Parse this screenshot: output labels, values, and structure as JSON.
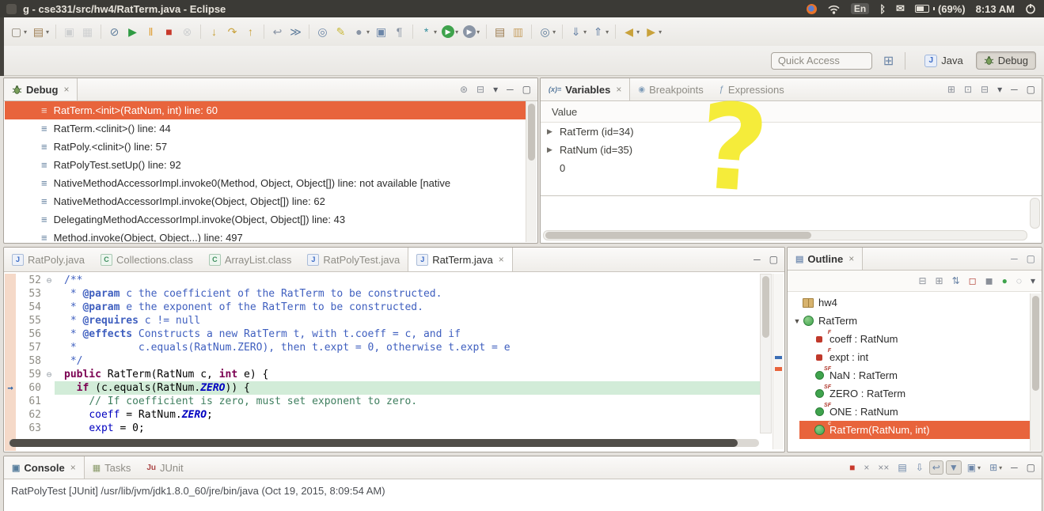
{
  "ui": {
    "close_glyph": "×",
    "menu_glyph": "▾",
    "min_glyph": "─",
    "max_glyph": "▢",
    "expand_glyph": "▶",
    "collapse_glyph": "▼",
    "fold_glyph": "⊖",
    "arrow_glyph": "→"
  },
  "titlebar": {
    "title": "g - cse331/src/hw4/RatTerm.java - Eclipse",
    "tray": [
      {
        "name": "firefox-indicator",
        "type": "firefox"
      },
      {
        "name": "network-indicator",
        "type": "wifi"
      },
      {
        "name": "keyboard-indicator",
        "type": "text-badge",
        "label": "En"
      },
      {
        "name": "bluetooth-indicator",
        "type": "glyph",
        "glyph": "ᛒ"
      },
      {
        "name": "mail-indicator",
        "type": "glyph",
        "glyph": "✉"
      },
      {
        "name": "battery-indicator",
        "type": "battery",
        "label": "(69%)"
      },
      {
        "name": "clock",
        "type": "text",
        "label": "8:13 AM"
      },
      {
        "name": "session-indicator",
        "type": "power"
      }
    ]
  },
  "toolbar": {
    "quick_access": "Quick Access",
    "open_perspective_glyph": "⊞",
    "perspectives": [
      {
        "label": "Java",
        "icon": "java",
        "active": false
      },
      {
        "label": "Debug",
        "icon": "bug",
        "active": true
      }
    ],
    "icons": [
      {
        "name": "new-wizard-button",
        "glyph": "▢",
        "color": "#8A8273",
        "dropdown": true
      },
      {
        "name": "new-java-project-button",
        "glyph": "▤",
        "color": "#9B7B4F",
        "dropdown": true
      },
      {
        "sep": true
      },
      {
        "name": "save-button",
        "glyph": "▣",
        "color": "#9AA0A8",
        "disabled": true
      },
      {
        "name": "save-all-button",
        "glyph": "▦",
        "color": "#9AA0A8",
        "disabled": true
      },
      {
        "sep": true
      },
      {
        "name": "skip-all-breakpoints-button",
        "glyph": "⊘",
        "color": "#5F7D9C"
      },
      {
        "name": "resume-button",
        "glyph": "▶",
        "color": "#2F9B43"
      },
      {
        "name": "suspend-button",
        "glyph": "‖",
        "color": "#DE9A2B"
      },
      {
        "name": "terminate-button",
        "glyph": "■",
        "color": "#C8392B"
      },
      {
        "name": "disconnect-button",
        "glyph": "⊗",
        "color": "#9AA0A8",
        "disabled": true
      },
      {
        "sep": true
      },
      {
        "name": "step-into-button",
        "glyph": "↓",
        "color": "#C9A23B"
      },
      {
        "name": "step-over-button",
        "glyph": "↷",
        "color": "#C9A23B"
      },
      {
        "name": "step-return-button",
        "glyph": "↑",
        "color": "#C9A23B"
      },
      {
        "sep": true
      },
      {
        "name": "drop-to-frame-button",
        "glyph": "↩",
        "color": "#8A95A5"
      },
      {
        "name": "use-step-filters-button",
        "glyph": "≫",
        "color": "#5F7D9C"
      },
      {
        "sep": true
      },
      {
        "name": "open-search-dialog-button",
        "glyph": "◎",
        "color": "#6C86A8"
      },
      {
        "name": "mark-occurrences-button",
        "glyph": "✎",
        "color": "#C9B93B"
      },
      {
        "name": "last-edit-location-button",
        "glyph": "●",
        "color": "#8A95A5",
        "dropdown": true
      },
      {
        "name": "pin-editor-button",
        "glyph": "▣",
        "color": "#6C86A8"
      },
      {
        "name": "show-whitespace-button",
        "glyph": "¶",
        "color": "#8A95A5"
      },
      {
        "sep": true
      },
      {
        "name": "new-java-class-button",
        "glyph": "*",
        "color": "#2E8B9B",
        "dropdown": true
      },
      {
        "name": "run-button",
        "glyph": "▶",
        "color": "#FFFFFF",
        "bg": "#3FA34D",
        "round": true,
        "dropdown": true
      },
      {
        "name": "external-tools-button",
        "glyph": "▶",
        "color": "#FFFFFF",
        "bg": "#8A95A5",
        "round": true,
        "dropdown": true
      },
      {
        "sep": true
      },
      {
        "name": "open-type-button",
        "glyph": "▤",
        "color": "#9B7B4F"
      },
      {
        "name": "open-resource-button",
        "glyph": "▥",
        "color": "#C8A165"
      },
      {
        "sep": true
      },
      {
        "name": "search-button",
        "glyph": "◎",
        "color": "#5F7D9C",
        "dropdown": true
      },
      {
        "sep": true
      },
      {
        "name": "next-annotation-button",
        "glyph": "⇓",
        "color": "#6C86A8",
        "dropdown": true
      },
      {
        "name": "previous-annotation-button",
        "glyph": "⇑",
        "color": "#6C86A8",
        "dropdown": true
      },
      {
        "sep": true
      },
      {
        "name": "back-button",
        "glyph": "◀",
        "color": "#C9A23B",
        "dropdown": true
      },
      {
        "name": "forward-button",
        "glyph": "▶",
        "color": "#C9A23B",
        "dropdown": true
      }
    ]
  },
  "debug_panel": {
    "tab_label": "Debug",
    "frame_icon_glyph": "≡",
    "toolbar_buttons": [
      {
        "name": "view-management-button",
        "glyph": "⊛",
        "color": "#8A8F98"
      },
      {
        "name": "collapse-all-button",
        "glyph": "⊟",
        "color": "#8A8F98"
      },
      {
        "name": "view-menu-button",
        "glyph": "▾",
        "color": "#5A5D63"
      },
      {
        "name": "minimize-button",
        "glyph": "─",
        "color": "#5A5D63"
      },
      {
        "name": "maximize-button",
        "glyph": "▢",
        "color": "#5A5D63"
      }
    ],
    "frames": [
      {
        "label": "RatTerm.<init>(RatNum, int) line: 60",
        "selected": true
      },
      {
        "label": "RatTerm.<clinit>() line: 44"
      },
      {
        "label": "RatPoly.<clinit>() line: 57"
      },
      {
        "label": "RatPolyTest.setUp() line: 92"
      },
      {
        "label": "NativeMethodAccessorImpl.invoke0(Method, Object, Object[]) line: not available [native"
      },
      {
        "label": "NativeMethodAccessorImpl.invoke(Object, Object[]) line: 62"
      },
      {
        "label": "DelegatingMethodAccessorImpl.invoke(Object, Object[]) line: 43"
      },
      {
        "label": "Method.invoke(Object, Object...) line: 497"
      }
    ]
  },
  "variables_panel": {
    "tabs": [
      {
        "label": "Variables",
        "icon": "variables-icon",
        "icon_text": "(x)=",
        "active": true,
        "closable": true
      },
      {
        "label": "Breakpoints",
        "icon": "breakpoints-icon",
        "icon_text": "◉"
      },
      {
        "label": "Expressions",
        "icon": "expressions-icon",
        "icon_text": "ƒ"
      }
    ],
    "toolbar_buttons": [
      {
        "name": "show-type-names-button",
        "glyph": "⊞",
        "color": "#8A8F98"
      },
      {
        "name": "show-logical-structure-button",
        "glyph": "⊡",
        "color": "#8A8F98"
      },
      {
        "name": "collapse-all-button",
        "glyph": "⊟",
        "color": "#8A8F98"
      },
      {
        "name": "view-menu-button",
        "glyph": "▾",
        "color": "#5A5D63"
      },
      {
        "name": "minimize-button",
        "glyph": "─",
        "color": "#5A5D63"
      },
      {
        "name": "maximize-button",
        "glyph": "▢",
        "color": "#5A5D63"
      }
    ],
    "column_header": "Value",
    "rows": [
      {
        "text": "RatTerm (id=34)",
        "expandable": true
      },
      {
        "text": "RatNum (id=35)",
        "expandable": true
      },
      {
        "text": "0",
        "expandable": false
      }
    ],
    "annotation_glyph": "?"
  },
  "editor": {
    "tabs": [
      {
        "label": "RatPoly.java",
        "kind": "java"
      },
      {
        "label": "Collections.class",
        "kind": "class"
      },
      {
        "label": "ArrayList.class",
        "kind": "class"
      },
      {
        "label": "RatPolyTest.java",
        "kind": "java"
      },
      {
        "label": "RatTerm.java",
        "kind": "java",
        "active": true
      }
    ],
    "toolbar_buttons": [
      {
        "name": "minimize-button",
        "glyph": "─",
        "color": "#5A5D63"
      },
      {
        "name": "maximize-button",
        "glyph": "▢",
        "color": "#5A5D63"
      }
    ],
    "lines": [
      {
        "num": 52,
        "fold": true,
        "segs": [
          [
            "/**",
            "jdoc"
          ]
        ]
      },
      {
        "num": 53,
        "segs": [
          [
            " * ",
            "jdoc"
          ],
          [
            "@param",
            "jtag"
          ],
          [
            " c the coefficient of the RatTerm to be constructed.",
            "jdoc"
          ]
        ]
      },
      {
        "num": 54,
        "segs": [
          [
            " * ",
            "jdoc"
          ],
          [
            "@param",
            "jtag"
          ],
          [
            " e the exponent of the RatTerm to be constructed.",
            "jdoc"
          ]
        ]
      },
      {
        "num": 55,
        "segs": [
          [
            " * ",
            "jdoc"
          ],
          [
            "@requires",
            "jtag"
          ],
          [
            " c != null",
            "jdoc"
          ]
        ]
      },
      {
        "num": 56,
        "segs": [
          [
            " * ",
            "jdoc"
          ],
          [
            "@effects",
            "jtag"
          ],
          [
            " Constructs a new RatTerm t, with t.coeff = c, and if",
            "jdoc"
          ]
        ]
      },
      {
        "num": 57,
        "segs": [
          [
            " *          c.equals(RatNum.ZERO), then t.expt = 0, otherwise t.expt = e",
            "jdoc"
          ]
        ]
      },
      {
        "num": 58,
        "segs": [
          [
            " */",
            "jdoc"
          ]
        ]
      },
      {
        "num": 59,
        "fold": true,
        "segs": [
          [
            "public",
            "kw"
          ],
          [
            " RatTerm(RatNum c, ",
            "pln"
          ],
          [
            "int",
            "kw"
          ],
          [
            " e) {",
            "pln"
          ]
        ]
      },
      {
        "num": 60,
        "current": true,
        "segs": [
          [
            "  ",
            "pln"
          ],
          [
            "if",
            "kw"
          ],
          [
            " (c.equals(RatNum.",
            "pln"
          ],
          [
            "ZERO",
            "sfield"
          ],
          [
            ")) {",
            "pln"
          ]
        ]
      },
      {
        "num": 61,
        "segs": [
          [
            "    ",
            "pln"
          ],
          [
            "// If coefficient is zero, must set exponent to zero.",
            "cmt"
          ]
        ]
      },
      {
        "num": 62,
        "segs": [
          [
            "    ",
            "pln"
          ],
          [
            "coeff",
            "field"
          ],
          [
            " = RatNum.",
            "pln"
          ],
          [
            "ZERO",
            "sfield"
          ],
          [
            ";",
            "pln"
          ]
        ]
      },
      {
        "num": 63,
        "segs": [
          [
            "    ",
            "pln"
          ],
          [
            "expt",
            "field"
          ],
          [
            " = 0;",
            "pln"
          ]
        ]
      }
    ]
  },
  "outline_panel": {
    "tab_label": "Outline",
    "tab_icon_glyph": "▤",
    "toolbar_buttons": [
      {
        "name": "collapse-all-button",
        "glyph": "⊟",
        "color": "#8A8F98"
      },
      {
        "name": "expand-all-button",
        "glyph": "⊞",
        "color": "#8A8F98"
      },
      {
        "name": "sort-button",
        "glyph": "⇅",
        "color": "#6C86A8"
      },
      {
        "name": "hide-fields-button",
        "glyph": "◻",
        "color": "#B03A2E"
      },
      {
        "name": "hide-static-members-button",
        "glyph": "◼",
        "color": "#8A8F98"
      },
      {
        "name": "hide-non-public-button",
        "glyph": "●",
        "color": "#3FA34D"
      },
      {
        "name": "hide-local-types-button",
        "glyph": "◌",
        "color": "#8A8F98"
      },
      {
        "name": "view-menu-button",
        "glyph": "▾",
        "color": "#5A5D63"
      }
    ],
    "items": [
      {
        "label": "hw4",
        "icon": "package",
        "indent": 0
      },
      {
        "label": "RatTerm",
        "icon": "class",
        "indent": 0,
        "expanded": true
      },
      {
        "label": "coeff : RatNum",
        "icon": "field-private",
        "indent": 1,
        "sup": "F"
      },
      {
        "label": "expt : int",
        "icon": "field-private",
        "indent": 1,
        "sup": "F"
      },
      {
        "label": "NaN : RatTerm",
        "icon": "field-static",
        "indent": 1,
        "sup": "SF"
      },
      {
        "label": "ZERO : RatTerm",
        "icon": "field-static",
        "indent": 1,
        "sup": "SF"
      },
      {
        "label": "ONE : RatNum",
        "icon": "field-static",
        "indent": 1,
        "sup": "SF"
      },
      {
        "label": "RatTerm(RatNum, int)",
        "icon": "constructor",
        "indent": 1,
        "sup": "c",
        "selected": true
      }
    ]
  },
  "console_panel": {
    "tabs": [
      {
        "label": "Console",
        "icon": "console-icon",
        "icon_text": "▣",
        "active": true,
        "closable": true
      },
      {
        "label": "Tasks",
        "icon": "tasks-icon",
        "icon_text": "▦"
      },
      {
        "label": "JUnit",
        "icon": "junit-icon",
        "icon_text": "Ju"
      }
    ],
    "toolbar_buttons": [
      {
        "name": "terminate-button",
        "glyph": "■",
        "color": "#C8392B"
      },
      {
        "name": "remove-launch-button",
        "glyph": "×",
        "color": "#8A8F98"
      },
      {
        "name": "remove-all-terminated-button",
        "glyph": "××",
        "color": "#8A8F98"
      },
      {
        "name": "clear-console-button",
        "glyph": "▤",
        "color": "#6C86A8"
      },
      {
        "name": "scroll-lock-button",
        "glyph": "⇩",
        "color": "#6C86A8"
      },
      {
        "name": "word-wrap-button",
        "glyph": "↩",
        "color": "#6C86A8",
        "pressed": true
      },
      {
        "name": "pin-console-button",
        "glyph": "▼",
        "color": "#6C86A8",
        "pressed": true
      },
      {
        "name": "display-selected-console-button",
        "glyph": "▣",
        "color": "#6C86A8",
        "dropdown": true
      },
      {
        "name": "open-console-button",
        "glyph": "⊞",
        "color": "#6C86A8",
        "dropdown": true
      },
      {
        "name": "minimize-button",
        "glyph": "─",
        "color": "#5A5D63"
      },
      {
        "name": "maximize-button",
        "glyph": "▢",
        "color": "#5A5D63"
      }
    ],
    "message": "RatPolyTest [JUnit] /usr/lib/jvm/jdk1.8.0_60/jre/bin/java (Oct 19, 2015, 8:09:54 AM)"
  }
}
